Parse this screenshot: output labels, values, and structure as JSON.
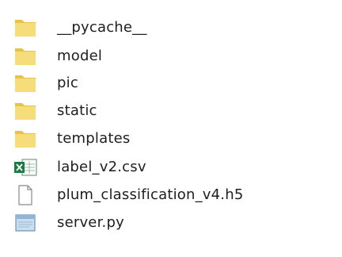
{
  "files": [
    {
      "name": "__pycache__",
      "icon": "folder-icon"
    },
    {
      "name": "model",
      "icon": "folder-icon"
    },
    {
      "name": "pic",
      "icon": "folder-icon"
    },
    {
      "name": "static",
      "icon": "folder-icon"
    },
    {
      "name": "templates",
      "icon": "folder-icon"
    },
    {
      "name": "label_v2.csv",
      "icon": "excel-csv-icon"
    },
    {
      "name": "plum_classification_v4.h5",
      "icon": "blank-file-icon"
    },
    {
      "name": "server.py",
      "icon": "python-file-icon"
    }
  ],
  "colors": {
    "folder": "#f7dc7a",
    "folder_dark": "#e8c24a",
    "excel_green": "#1f7a40",
    "file_outline": "#8a8a8a",
    "python_blue": "#8fb6d8",
    "text": "#1e1e1e"
  }
}
